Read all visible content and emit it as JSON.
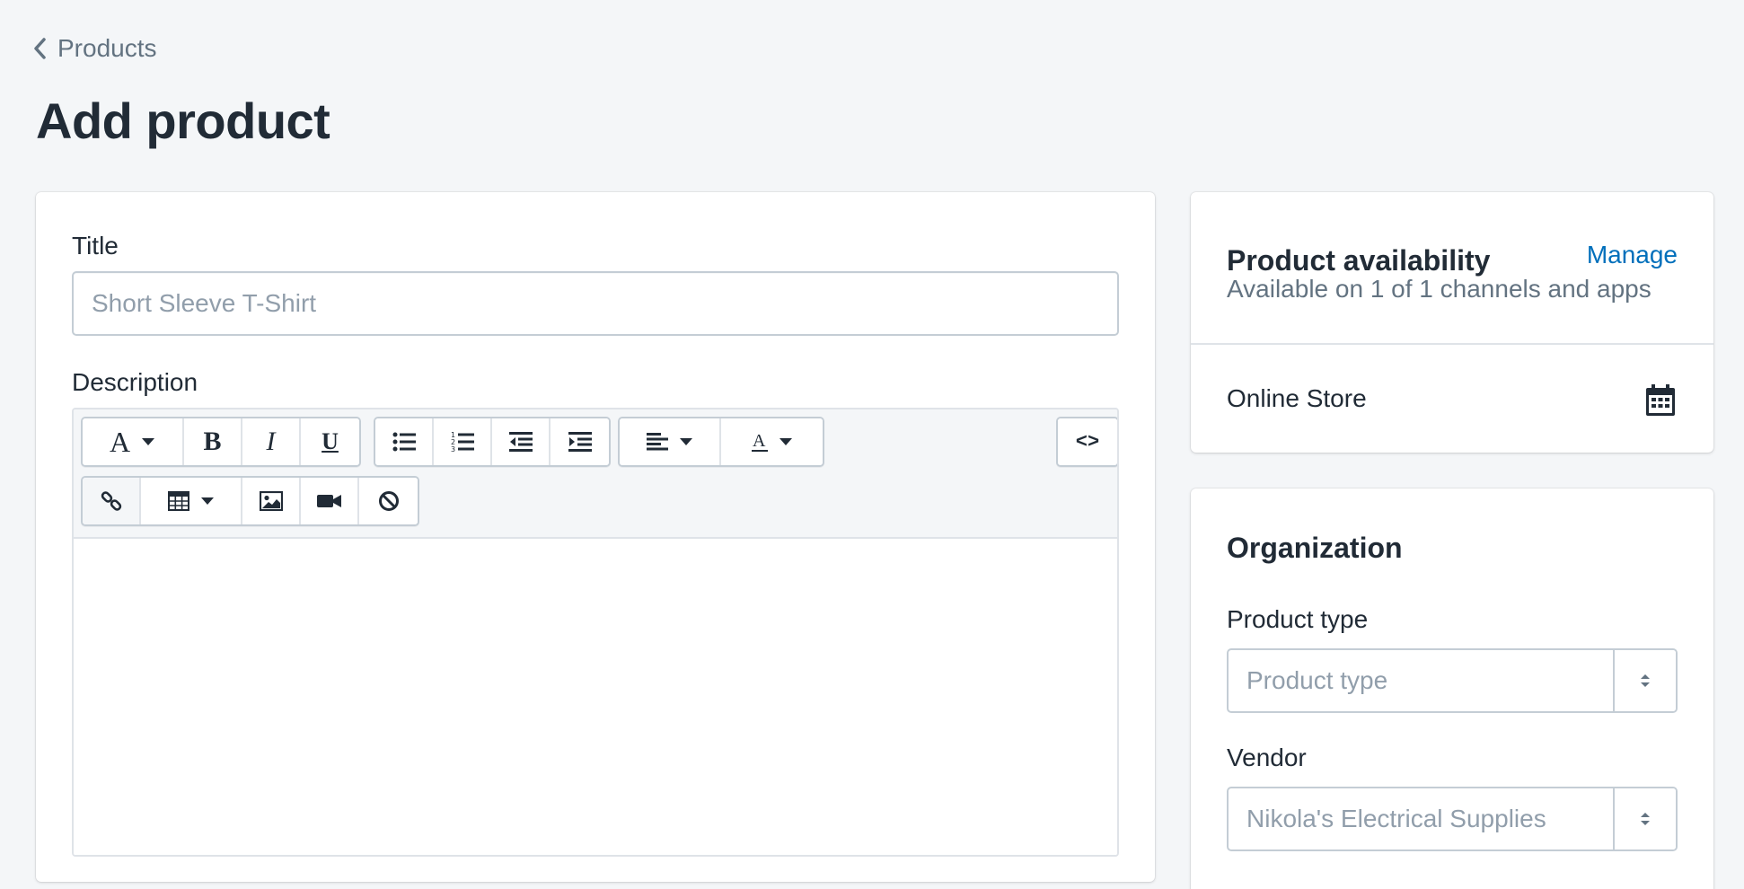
{
  "breadcrumb": {
    "label": "Products"
  },
  "page": {
    "title": "Add product"
  },
  "product_form": {
    "title_label": "Title",
    "title_placeholder": "Short Sleeve T-Shirt",
    "description_label": "Description",
    "toolbar": {
      "row1": [
        {
          "name": "font-style",
          "icon": "font-a-icon",
          "glyph": "A",
          "dropdown": true
        },
        {
          "name": "bold",
          "icon": "bold-icon",
          "glyph": "B"
        },
        {
          "name": "italic",
          "icon": "italic-icon",
          "glyph": "I"
        },
        {
          "name": "underline",
          "icon": "underline-icon",
          "glyph": "U"
        },
        {
          "name": "bulleted-list",
          "icon": "bulleted-list-icon"
        },
        {
          "name": "numbered-list",
          "icon": "numbered-list-icon"
        },
        {
          "name": "outdent",
          "icon": "outdent-icon"
        },
        {
          "name": "indent",
          "icon": "indent-icon"
        },
        {
          "name": "align",
          "icon": "align-left-icon",
          "dropdown": true
        },
        {
          "name": "text-color",
          "icon": "text-color-icon",
          "glyph": "A",
          "dropdown": true
        },
        {
          "name": "html",
          "icon": "code-icon",
          "glyph": "<>"
        }
      ],
      "row2": [
        {
          "name": "link",
          "icon": "link-icon"
        },
        {
          "name": "table",
          "icon": "table-icon",
          "dropdown": true
        },
        {
          "name": "image",
          "icon": "image-icon"
        },
        {
          "name": "video",
          "icon": "video-icon"
        },
        {
          "name": "clear-formatting",
          "icon": "clear-formatting-icon"
        }
      ]
    }
  },
  "availability": {
    "title": "Product availability",
    "manage_label": "Manage",
    "subtitle": "Available on 1 of 1 channels and apps",
    "channels": [
      {
        "name": "Online Store",
        "icon": "calendar-icon"
      }
    ]
  },
  "organization": {
    "title": "Organization",
    "product_type_label": "Product type",
    "product_type_placeholder": "Product type",
    "vendor_label": "Vendor",
    "vendor_placeholder": "Nikola's Electrical Supplies"
  },
  "colors": {
    "page_background": "#f4f6f8",
    "link": "#006fbb",
    "text": "#212b36",
    "subdued_text": "#637381",
    "placeholder": "#919eab",
    "border": "#c4cdd5"
  }
}
